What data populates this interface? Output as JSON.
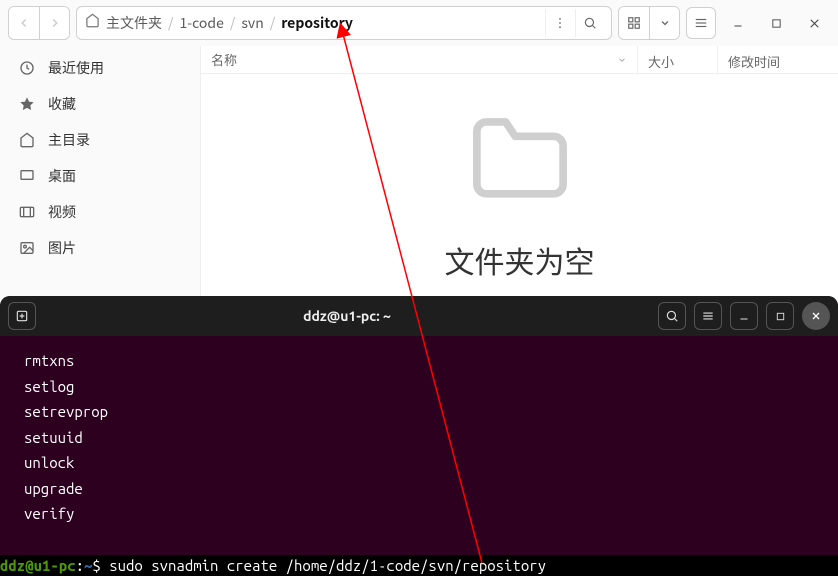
{
  "file_manager": {
    "breadcrumb": {
      "home_label": "主文件夹",
      "segments": [
        "1-code",
        "svn",
        "repository"
      ]
    },
    "sidebar": {
      "items": [
        {
          "label": "最近使用",
          "icon": "clock-icon"
        },
        {
          "label": "收藏",
          "icon": "star-icon"
        },
        {
          "label": "主目录",
          "icon": "home-icon"
        },
        {
          "label": "桌面",
          "icon": "desktop-icon"
        },
        {
          "label": "视频",
          "icon": "video-icon"
        },
        {
          "label": "图片",
          "icon": "image-icon"
        }
      ]
    },
    "columns": {
      "name": "名称",
      "size": "大小",
      "mtime": "修改时间"
    },
    "empty_text": "文件夹为空"
  },
  "terminal": {
    "title": "ddz@u1-pc: ~",
    "output_lines": [
      "rmtxns",
      "setlog",
      "setrevprop",
      "setuuid",
      "unlock",
      "upgrade",
      "verify"
    ],
    "prompt": {
      "user_host": "ddz@u1-pc",
      "path": "~",
      "command": "sudo svnadmin create /home/ddz/1-code/svn/repository"
    }
  }
}
